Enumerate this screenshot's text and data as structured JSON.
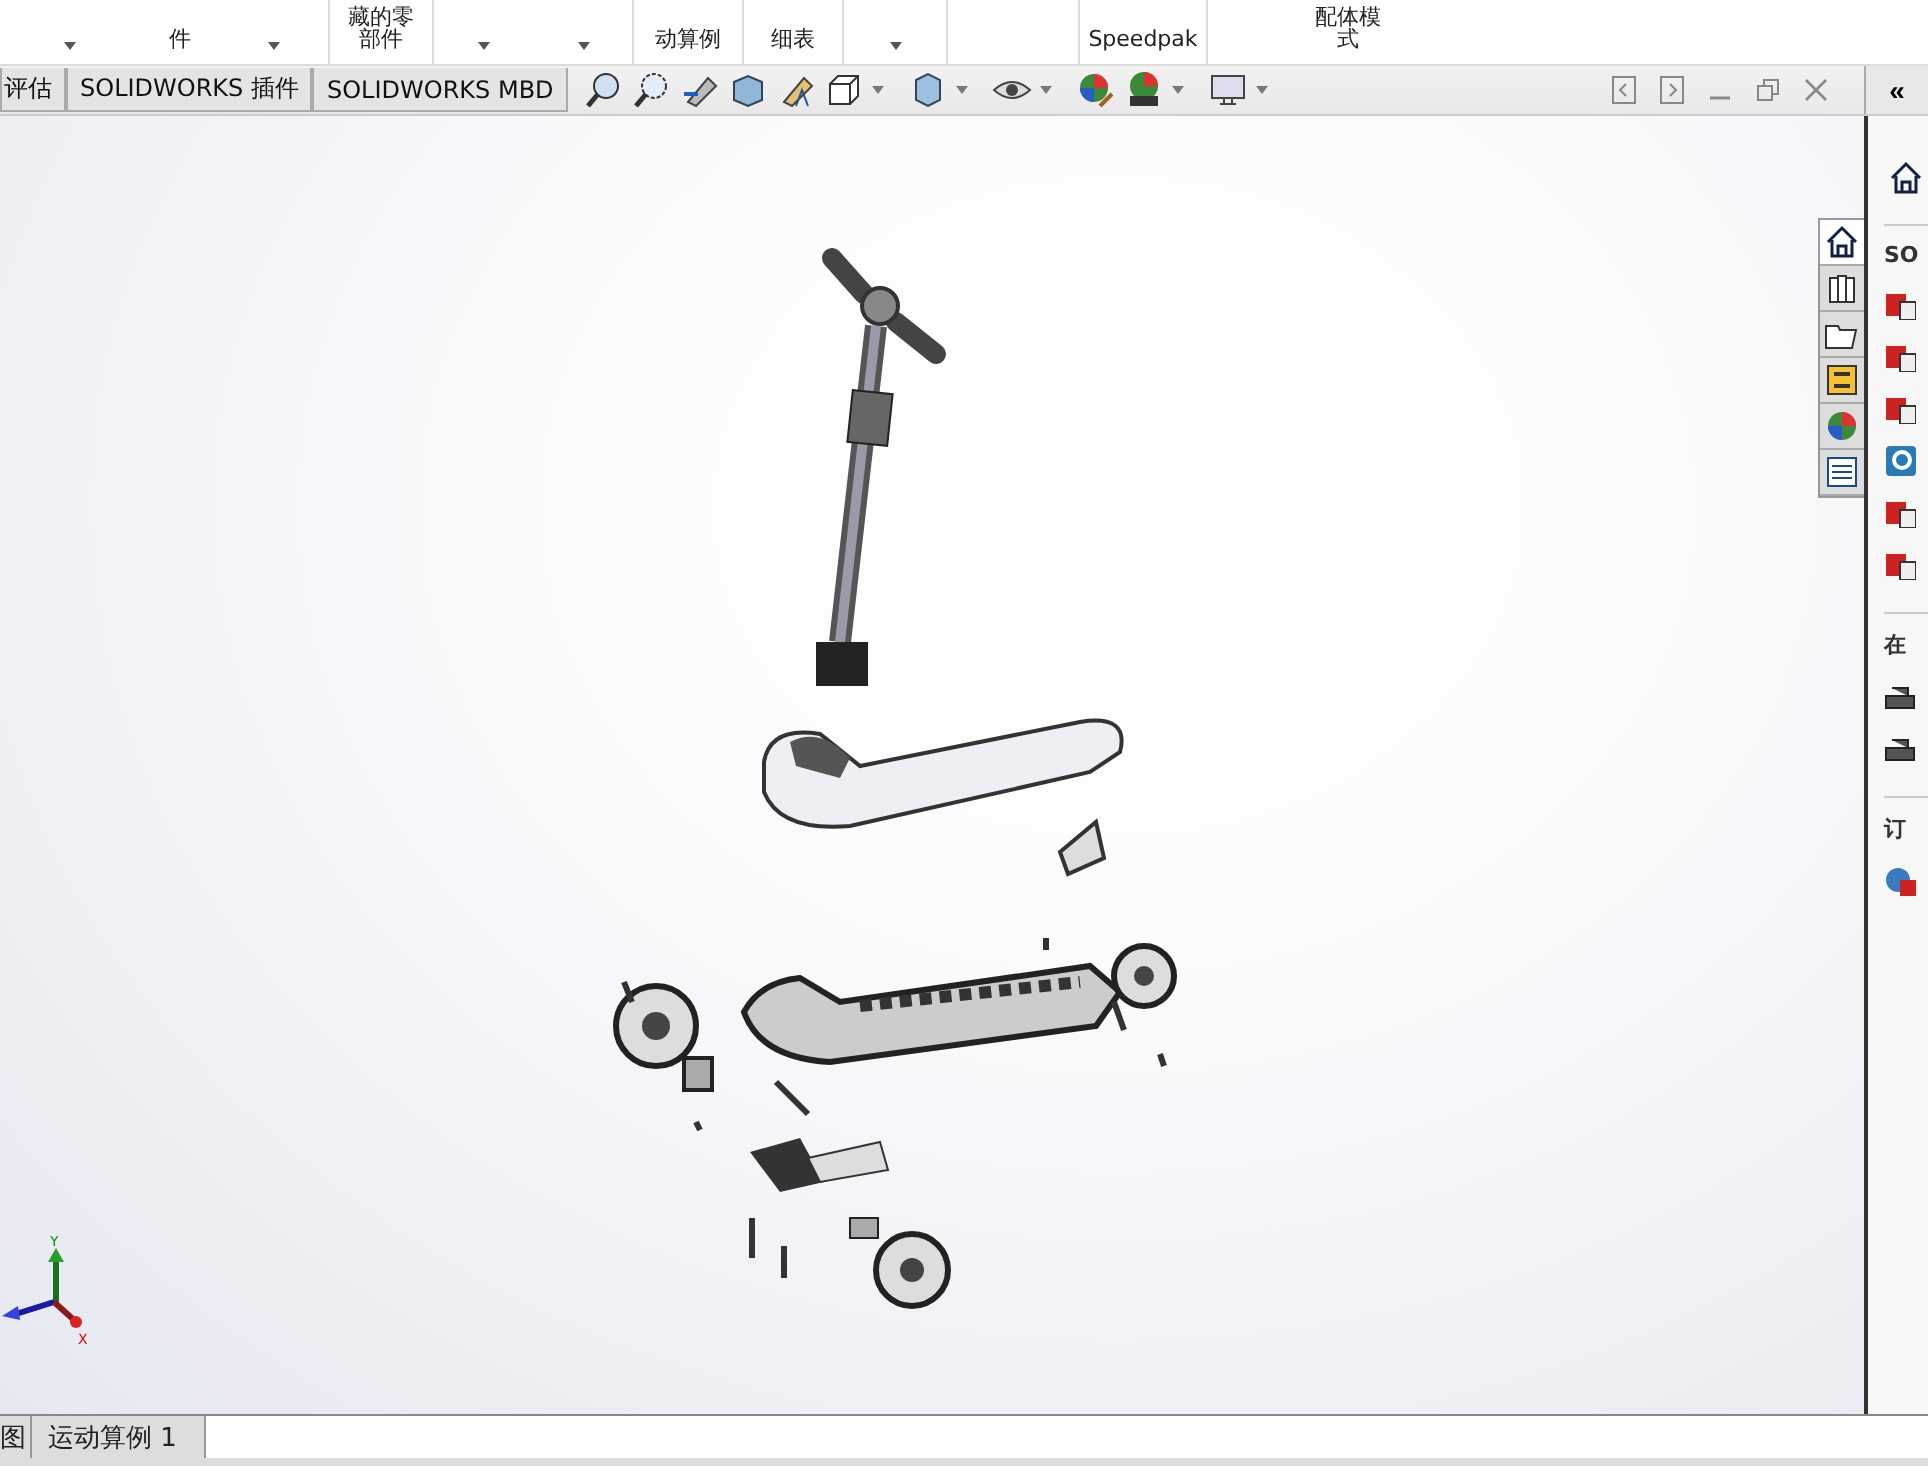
{
  "ribbon": {
    "items": [
      {
        "caret": true
      },
      {
        "lines": [
          "件"
        ]
      },
      {
        "caret": true
      },
      {
        "lines": [
          "藏的零",
          "部件"
        ]
      },
      {
        "caret": true
      },
      {
        "caret": true
      },
      {
        "lines": [
          "动算例"
        ]
      },
      {
        "lines": [
          "细表"
        ]
      },
      {
        "caret": true
      },
      {
        "lines": [
          "Speedpak"
        ]
      },
      {
        "lines": [
          "配体模",
          "式"
        ]
      }
    ]
  },
  "command_tabs": [
    {
      "label": "评估",
      "selected": false
    },
    {
      "label": "SOLIDWORKS 插件",
      "selected": false
    },
    {
      "label": "SOLIDWORKS MBD",
      "selected": false
    }
  ],
  "collapse_button": "«",
  "task_pane_tabs": [
    {
      "selected": true
    },
    {
      "selected": false
    },
    {
      "selected": false
    },
    {
      "selected": false
    },
    {
      "selected": false
    },
    {
      "selected": false
    }
  ],
  "task_pane": {
    "sections": [
      {
        "heading": "SO"
      },
      {
        "heading": "在"
      },
      {
        "heading": "订"
      }
    ]
  },
  "triad": {
    "y_label": "Y",
    "x_label": "X"
  },
  "bottom_tabs": [
    {
      "label": "图",
      "selected": false
    },
    {
      "label": "运动算例 1",
      "selected": false
    }
  ]
}
